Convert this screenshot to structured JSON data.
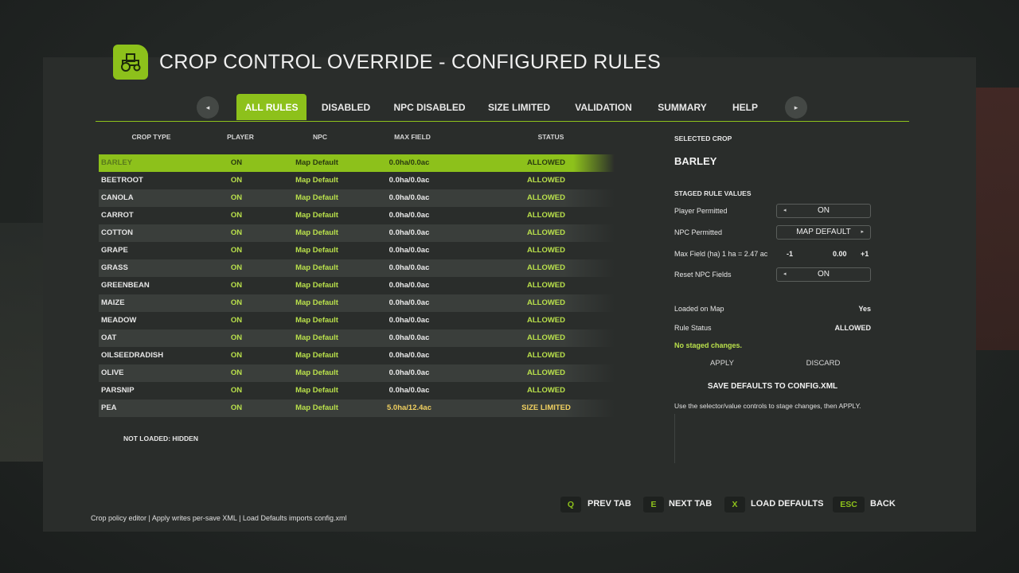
{
  "title": "CROP CONTROL OVERRIDE - CONFIGURED RULES",
  "logo_icon": "tractor-icon",
  "accent_color": "#8dc11b",
  "tabs": [
    {
      "label": "ALL RULES",
      "active": true
    },
    {
      "label": "DISABLED"
    },
    {
      "label": "NPC DISABLED"
    },
    {
      "label": "SIZE LIMITED"
    },
    {
      "label": "VALIDATION"
    },
    {
      "label": "SUMMARY"
    },
    {
      "label": "HELP"
    }
  ],
  "tab_prev_icon": "◂",
  "tab_next_icon": "▸",
  "table": {
    "headers": {
      "crop": "CROP TYPE",
      "player": "PLAYER",
      "npc": "NPC",
      "max": "MAX FIELD",
      "status": "STATUS"
    },
    "rows": [
      {
        "crop": "BARLEY",
        "player": "ON",
        "npc": "Map Default",
        "max": "0.0ha/0.0ac",
        "status": "ALLOWED"
      },
      {
        "crop": "BEETROOT",
        "player": "ON",
        "npc": "Map Default",
        "max": "0.0ha/0.0ac",
        "status": "ALLOWED"
      },
      {
        "crop": "CANOLA",
        "player": "ON",
        "npc": "Map Default",
        "max": "0.0ha/0.0ac",
        "status": "ALLOWED"
      },
      {
        "crop": "CARROT",
        "player": "ON",
        "npc": "Map Default",
        "max": "0.0ha/0.0ac",
        "status": "ALLOWED"
      },
      {
        "crop": "COTTON",
        "player": "ON",
        "npc": "Map Default",
        "max": "0.0ha/0.0ac",
        "status": "ALLOWED"
      },
      {
        "crop": "GRAPE",
        "player": "ON",
        "npc": "Map Default",
        "max": "0.0ha/0.0ac",
        "status": "ALLOWED"
      },
      {
        "crop": "GRASS",
        "player": "ON",
        "npc": "Map Default",
        "max": "0.0ha/0.0ac",
        "status": "ALLOWED"
      },
      {
        "crop": "GREENBEAN",
        "player": "ON",
        "npc": "Map Default",
        "max": "0.0ha/0.0ac",
        "status": "ALLOWED"
      },
      {
        "crop": "MAIZE",
        "player": "ON",
        "npc": "Map Default",
        "max": "0.0ha/0.0ac",
        "status": "ALLOWED"
      },
      {
        "crop": "MEADOW",
        "player": "ON",
        "npc": "Map Default",
        "max": "0.0ha/0.0ac",
        "status": "ALLOWED"
      },
      {
        "crop": "OAT",
        "player": "ON",
        "npc": "Map Default",
        "max": "0.0ha/0.0ac",
        "status": "ALLOWED"
      },
      {
        "crop": "OILSEEDRADISH",
        "player": "ON",
        "npc": "Map Default",
        "max": "0.0ha/0.0ac",
        "status": "ALLOWED"
      },
      {
        "crop": "OLIVE",
        "player": "ON",
        "npc": "Map Default",
        "max": "0.0ha/0.0ac",
        "status": "ALLOWED"
      },
      {
        "crop": "PARSNIP",
        "player": "ON",
        "npc": "Map Default",
        "max": "0.0ha/0.0ac",
        "status": "ALLOWED"
      },
      {
        "crop": "PEA",
        "player": "ON",
        "npc": "Map Default",
        "max": "5.0ha/12.4ac",
        "status": "SIZE LIMITED"
      }
    ],
    "footer_note": "NOT LOADED: HIDDEN"
  },
  "side": {
    "selected_heading": "SELECTED CROP",
    "selected_crop": "BARLEY",
    "staged_heading": "STAGED RULE VALUES",
    "player_label": "Player Permitted",
    "player_value": "ON",
    "npc_label": "NPC Permitted",
    "npc_value": "MAP DEFAULT",
    "maxfield_label": "Max Field (ha) 1 ha = 2.47 ac",
    "step_minus": "-1",
    "step_value": "0.00",
    "step_plus": "+1",
    "reset_label": "Reset NPC Fields",
    "reset_value": "ON",
    "loaded_label": "Loaded on Map",
    "loaded_value": "Yes",
    "status_label": "Rule Status",
    "status_value": "ALLOWED",
    "note": "No staged changes.",
    "apply": "APPLY",
    "discard": "DISCARD",
    "save_defaults": "SAVE DEFAULTS TO CONFIG.XML",
    "help": "Use the selector/value controls to stage changes, then APPLY.",
    "arrow_left": "◂",
    "arrow_right": "▸"
  },
  "footer": {
    "hint": "Crop policy editor | Apply writes per-save XML | Load Defaults imports config.xml",
    "keys": [
      {
        "key": "Q",
        "label": "PREV TAB"
      },
      {
        "key": "E",
        "label": "NEXT TAB"
      },
      {
        "key": "X",
        "label": "LOAD DEFAULTS"
      },
      {
        "key": "ESC",
        "label": "BACK"
      }
    ]
  }
}
